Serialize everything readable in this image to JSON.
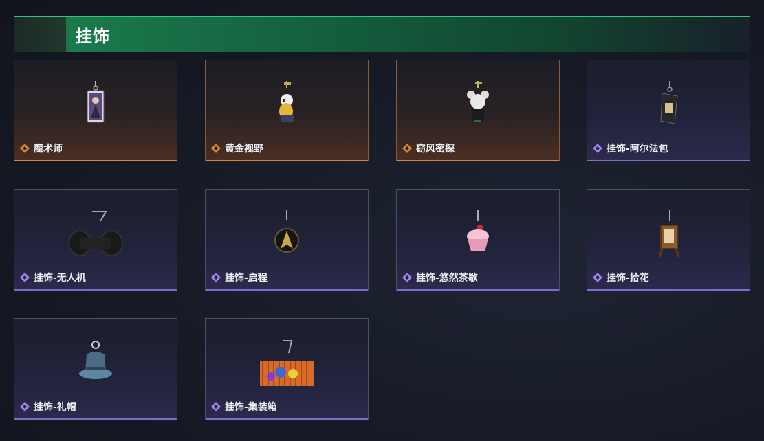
{
  "section": {
    "title": "挂饰"
  },
  "items": [
    {
      "name": "魔术师",
      "rarity": "gold",
      "icon": "magician-charm-icon"
    },
    {
      "name": "黄金视野",
      "rarity": "gold",
      "icon": "golden-vision-charm-icon"
    },
    {
      "name": "窃风密探",
      "rarity": "gold",
      "icon": "wind-spy-charm-icon"
    },
    {
      "name": "挂饰-阿尔法包",
      "rarity": "purple",
      "icon": "alpha-pack-charm-icon"
    },
    {
      "name": "挂饰-无人机",
      "rarity": "purple",
      "icon": "drone-charm-icon"
    },
    {
      "name": "挂饰-启程",
      "rarity": "purple",
      "icon": "departure-charm-icon"
    },
    {
      "name": "挂饰-悠然茶歇",
      "rarity": "purple",
      "icon": "cupcake-charm-icon"
    },
    {
      "name": "挂饰-拾花",
      "rarity": "purple",
      "icon": "picking-flowers-charm-icon"
    },
    {
      "name": "挂饰-礼帽",
      "rarity": "purple",
      "icon": "top-hat-charm-icon"
    },
    {
      "name": "挂饰-集装箱",
      "rarity": "purple",
      "icon": "container-charm-icon"
    }
  ],
  "colors": {
    "gold_accent": "#d9823b",
    "purple_accent": "#7d6bd0",
    "header_green": "#1a7a4c"
  }
}
